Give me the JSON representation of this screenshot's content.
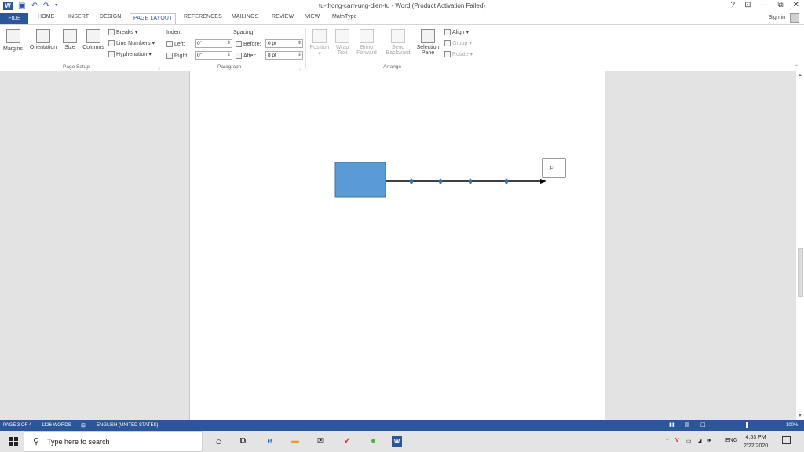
{
  "title_bar": {
    "document_title": "tu-thong-cam-ung-dien-tu - Word (Product Activation Failed)",
    "app_icon_label": "W",
    "controls": [
      "?",
      "⊡",
      "—",
      "⧉",
      "✕"
    ]
  },
  "tabs": [
    "FILE",
    "HOME",
    "INSERT",
    "DESIGN",
    "PAGE LAYOUT",
    "REFERENCES",
    "MAILINGS",
    "REVIEW",
    "VIEW",
    "MathType"
  ],
  "active_tab": "PAGE LAYOUT",
  "sign_in_label": "Sign in",
  "ribbon": {
    "page_setup": {
      "label": "Page Setup",
      "buttons": [
        "Margins",
        "Orientation",
        "Size",
        "Columns"
      ],
      "breaks": "Breaks",
      "line_numbers": "Line Numbers",
      "hyphenation": "Hyphenation"
    },
    "paragraph": {
      "label": "Paragraph",
      "indent_title": "Indent",
      "spacing_title": "Spacing",
      "left_label": "Left:",
      "left_value": "0\"",
      "right_label": "Right:",
      "right_value": "0\"",
      "before_label": "Before:",
      "before_value": "0 pt",
      "after_label": "After:",
      "after_value": "8 pt"
    },
    "arrange": {
      "label": "Arrange",
      "position": "Position",
      "wrap_text": [
        "Wrap",
        "Text"
      ],
      "bring_forward": [
        "Bring",
        "Forward"
      ],
      "send_backward": [
        "Send",
        "Backward"
      ],
      "selection_pane": [
        "Selection",
        "Pane"
      ],
      "align": "Align",
      "group": "Group",
      "rotate": "Rotate"
    }
  },
  "document": {
    "force_label": "F⃗",
    "colors": {
      "box_fill": "#5b9bd5",
      "box_stroke": "#41719c",
      "arrow": "#000000",
      "dot": "#2e75b6"
    }
  },
  "status_bar": {
    "page": "PAGE 3 OF 4",
    "words": "1126 WORDS",
    "language": "ENGLISH (UNITED STATES)",
    "zoom": "100%"
  },
  "taskbar": {
    "search_placeholder": "Type here to search",
    "language": "ENG",
    "time": "4:53 PM",
    "date": "2/22/2020"
  },
  "colors": {
    "accent": "#2b579a",
    "taskbar": "#e4e4e4"
  }
}
